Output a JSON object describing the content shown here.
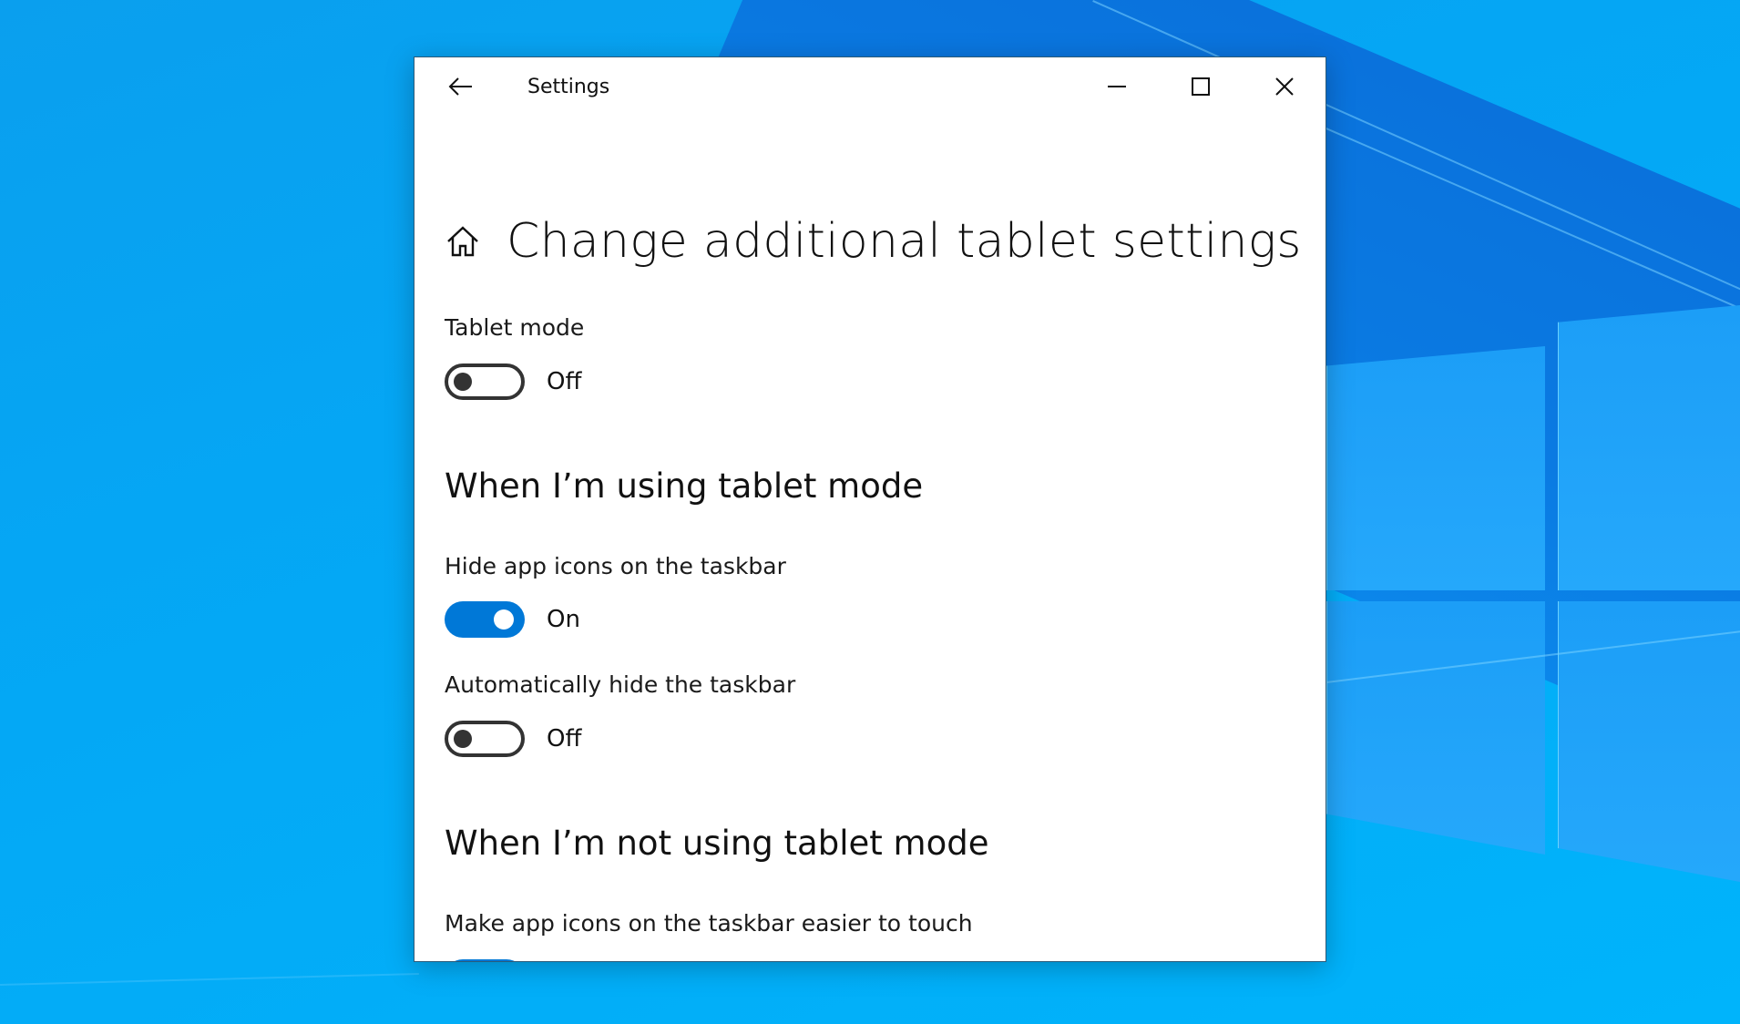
{
  "window": {
    "title": "Settings",
    "caption_buttons": {
      "minimize": "minimize-icon",
      "maximize": "maximize-icon",
      "close": "close-icon"
    },
    "back_icon": "back-arrow-icon"
  },
  "page": {
    "home_icon": "home-icon",
    "title": "Change additional tablet settings"
  },
  "tablet_mode": {
    "label": "Tablet mode",
    "state": "Off",
    "enabled": false
  },
  "section_using": {
    "heading": "When I’m using tablet mode",
    "settings": [
      {
        "label": "Hide app icons on the taskbar",
        "state": "On",
        "enabled": true
      },
      {
        "label": "Automatically hide the taskbar",
        "state": "Off",
        "enabled": false
      }
    ]
  },
  "section_not_using": {
    "heading": "When I’m not using tablet mode",
    "settings": [
      {
        "label": "Make app icons on the taskbar easier to touch",
        "state": "On",
        "enabled": true
      }
    ]
  },
  "colors": {
    "accent": "#0078d7",
    "toggle_off": "#333333",
    "scrollbar": "#858585"
  }
}
